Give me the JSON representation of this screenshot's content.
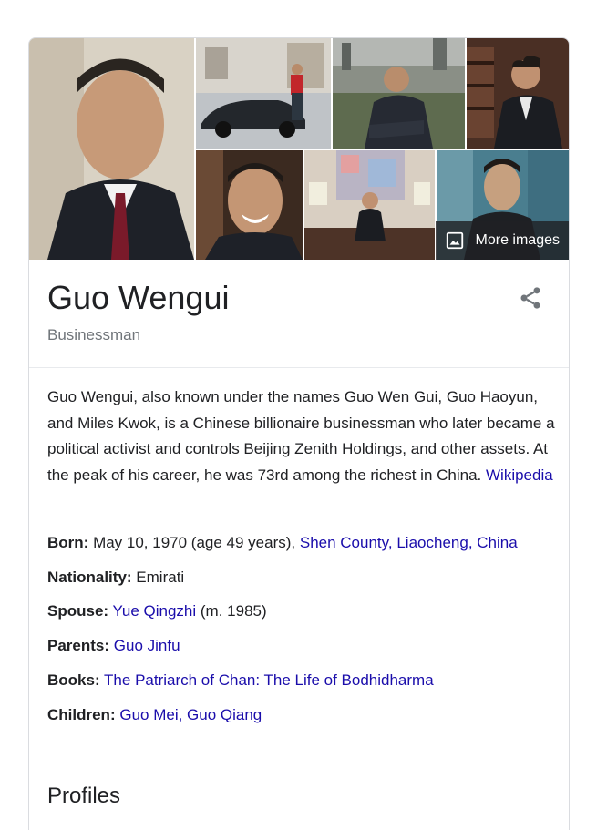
{
  "gallery": {
    "images": [
      {
        "alt": "main-portrait"
      },
      {
        "alt": "car-photo"
      },
      {
        "alt": "rooftop-photo"
      },
      {
        "alt": "library-photo"
      },
      {
        "alt": "smiling-photo"
      },
      {
        "alt": "office-photo"
      },
      {
        "alt": "blue-background-photo"
      }
    ],
    "more_images_label": "More images"
  },
  "entity": {
    "title": "Guo Wengui",
    "subtitle": "Businessman"
  },
  "description": {
    "text": "Guo Wengui, also known under the names Guo Wen Gui, Guo Haoyun, and Miles Kwok, is a Chinese billionaire businessman who later became a political activist and controls Beijing Zenith Holdings, and other assets. At the peak of his career, he was 73rd among the richest in China. ",
    "source": "Wikipedia"
  },
  "facts": {
    "born": {
      "label": "Born:",
      "text": "May 10, 1970 (age 49 years), ",
      "place_1": "Shen County",
      "sep": ", ",
      "place_2": "Liaocheng",
      "place_3": "China"
    },
    "nationality": {
      "label": "Nationality:",
      "text": "Emirati"
    },
    "spouse": {
      "label": "Spouse:",
      "link": "Yue Qingzhi",
      "text": " (m. 1985)"
    },
    "parents": {
      "label": "Parents:",
      "link": "Guo Jinfu"
    },
    "books": {
      "label": "Books:",
      "link": "The Patriarch of Chan: The Life of Bodhidharma"
    },
    "children": {
      "label": "Children:",
      "link_1": "Guo Mei",
      "sep": ", ",
      "link_2": "Guo Qiang"
    }
  },
  "profiles_heading": "Profiles",
  "icons": {
    "share": "share-icon",
    "image": "image-icon"
  }
}
